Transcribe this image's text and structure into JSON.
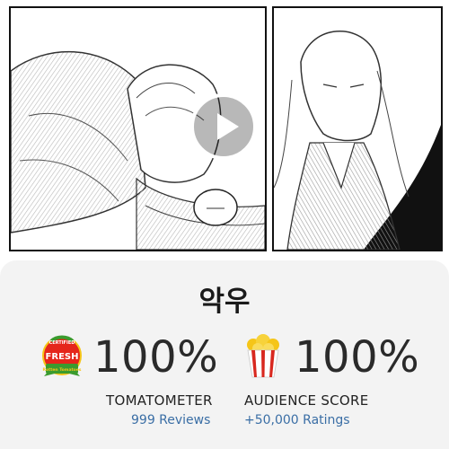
{
  "video": {
    "thumbnail": "manga-panels-sleeping-characters",
    "play_icon": "play-icon"
  },
  "card": {
    "title": "악우",
    "tomatometer": {
      "badge_icon": "certified-fresh-icon",
      "badge_text_top": "CERTIFIED",
      "badge_text_main": "FRESH",
      "badge_text_sub": "Rotten Tomatoes",
      "score": "100%",
      "label": "TOMATOMETER",
      "reviews": "999 Reviews"
    },
    "audience": {
      "icon": "popcorn-icon",
      "score": "100%",
      "label": "AUDIENCE SCORE",
      "ratings": "+50,000 Ratings"
    }
  },
  "colors": {
    "card_bg": "#f3f3f3",
    "link": "#3a6ea5",
    "fresh_red": "#e5261b",
    "fresh_green": "#3a9b2e",
    "popcorn_stripe": "#d8281f",
    "popcorn_yellow": "#f5c518"
  }
}
